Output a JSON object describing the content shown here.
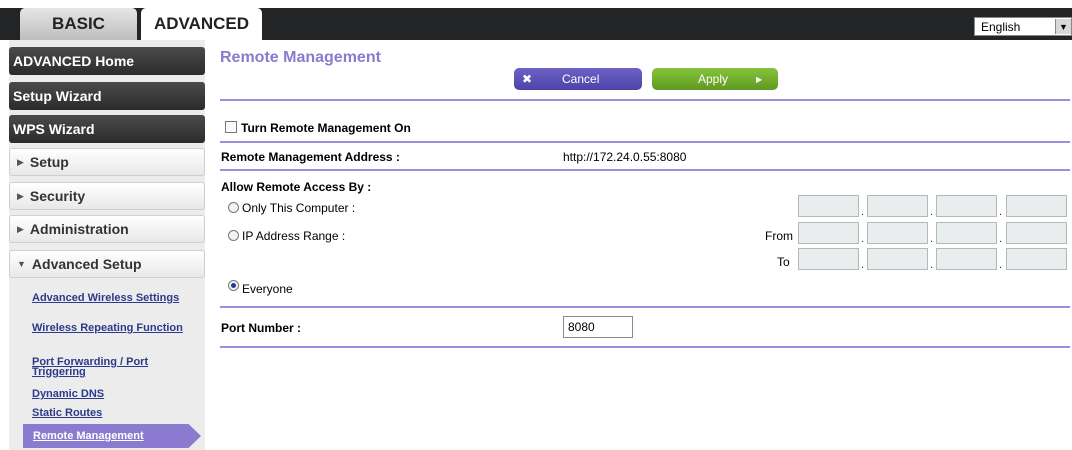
{
  "tabs": {
    "basic": "BASIC",
    "advanced": "ADVANCED"
  },
  "language": {
    "selected": "English"
  },
  "sidebar": {
    "main_items": [
      {
        "label": "ADVANCED Home"
      },
      {
        "label": "Setup Wizard"
      },
      {
        "label": "WPS Wizard"
      }
    ],
    "sections": [
      {
        "label": "Setup",
        "expanded": false
      },
      {
        "label": "Security",
        "expanded": false
      },
      {
        "label": "Administration",
        "expanded": false
      },
      {
        "label": "Advanced Setup",
        "expanded": true
      }
    ],
    "sub_items": [
      {
        "label": "Advanced Wireless Settings"
      },
      {
        "label": "Wireless Repeating Function"
      },
      {
        "label": "Port Forwarding / Port Triggering"
      },
      {
        "label": "Dynamic DNS"
      },
      {
        "label": "Static Routes"
      },
      {
        "label": "Remote Management"
      }
    ]
  },
  "page": {
    "title": "Remote Management",
    "cancel_label": "Cancel",
    "apply_label": "Apply",
    "turn_on_label": "Turn Remote Management On",
    "turn_on_checked": false,
    "address_label": "Remote Management Address :",
    "address_value": "http://172.24.0.55:8080",
    "allow_label": "Allow Remote Access By :",
    "option_only_this": "Only This Computer :",
    "option_ip_range": "IP Address Range :",
    "option_everyone": "Everyone",
    "selected_option": "Everyone",
    "from_label": "From",
    "to_label": "To",
    "dot_sep": ".",
    "port_label": "Port Number :",
    "port_value": "8080"
  },
  "colors": {
    "accent_purple": "#8a7ad0",
    "apply_green": "#6fae2c",
    "cancel_purple": "#5a4fb5",
    "topbar_dark": "#222426"
  }
}
